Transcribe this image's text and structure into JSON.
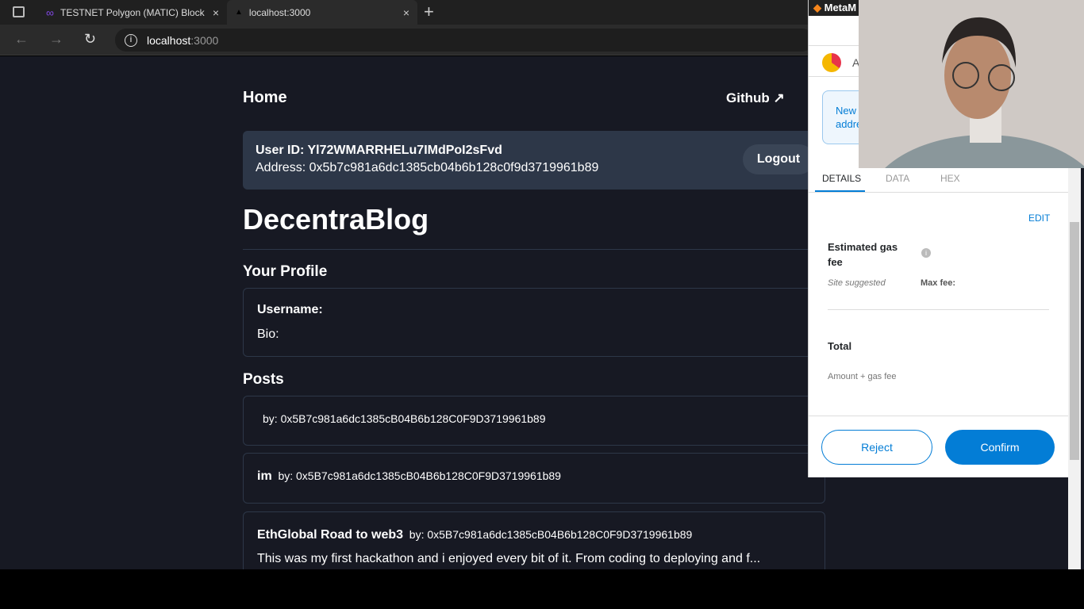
{
  "browser": {
    "tabs": [
      {
        "label": "TESTNET Polygon (MATIC) Block",
        "icon": "polygon-icon"
      },
      {
        "label": "localhost:3000",
        "icon": "site-icon"
      }
    ],
    "url_host": "localhost",
    "url_port": ":3000"
  },
  "page": {
    "nav_home": "Home",
    "nav_github": "Github",
    "user_id": "User ID: Yl72WMARRHELu7IMdPoI2sFvd",
    "address": "Address: 0x5b7c981a6dc1385cb04b6b128c0f9d3719961b89",
    "logout": "Logout",
    "title": "DecentraBlog",
    "profile_heading": "Your Profile",
    "username_label": "Username:",
    "bio_label": "Bio:",
    "posts_heading": "Posts",
    "posts": [
      {
        "title": "",
        "by": "by: 0x5B7c981a6dc1385cB04B6b128C0F9D3719961b89",
        "body": ""
      },
      {
        "title": "im",
        "by": "by: 0x5B7c981a6dc1385cB04B6b128C0F9D3719961b89",
        "body": ""
      },
      {
        "title": "EthGlobal Road to web3",
        "by": "by: 0x5B7c981a6dc1385cB04B6b128C0F9D3719961b89",
        "body": "This was my first hackathon and i enjoyed every bit of it. From coding to deploying and f..."
      }
    ]
  },
  "metamask": {
    "title": "MetaM",
    "account_initial": "A",
    "notice": [
      "New",
      "addre"
    ],
    "tabs": [
      "DETAILS",
      "DATA",
      "HEX"
    ],
    "edit": "EDIT",
    "gas_label": "Estimated gas fee",
    "site_suggested": "Site suggested",
    "max_fee": "Max fee:",
    "total": "Total",
    "amount_gas": "Amount + gas fee",
    "reject": "Reject",
    "confirm": "Confirm",
    "accent": "#037dd6"
  }
}
